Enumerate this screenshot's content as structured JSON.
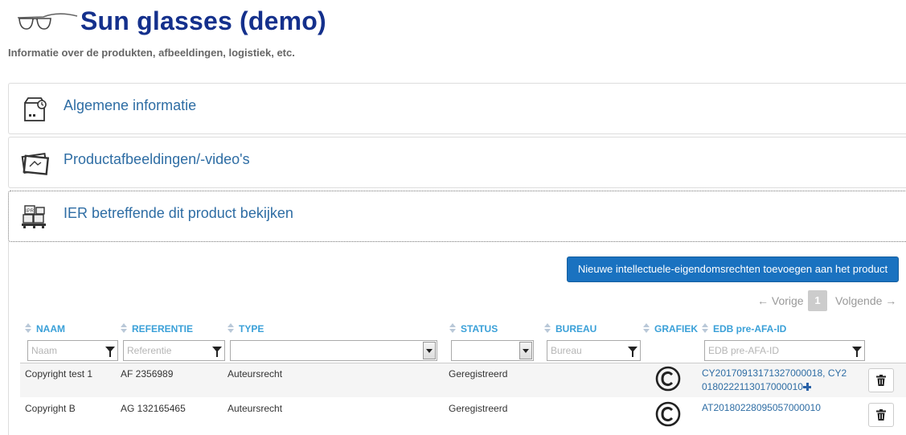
{
  "header": {
    "title": "Sun glasses (demo)",
    "subtitle": "Informatie over de produkten, afbeeldingen, logistiek, etc."
  },
  "panels": [
    {
      "label": "Algemene informatie",
      "icon": "box-icon"
    },
    {
      "label": "Productafbeeldingen/-video's",
      "icon": "photos-icon"
    },
    {
      "label": "IER betreffende dit product bekijken",
      "icon": "ipr-pallet-icon"
    }
  ],
  "toolbar": {
    "add_button": "Nieuwe intellectuele-eigendomsrechten toevoegen aan het product"
  },
  "pager": {
    "prev": "← Vorige",
    "page": "1",
    "next": "Volgende →"
  },
  "table": {
    "columns": [
      {
        "label": "NAAM",
        "sortable": true,
        "filter_placeholder": "Naam",
        "filter_type": "text"
      },
      {
        "label": "REFERENTIE",
        "sortable": true,
        "filter_placeholder": "Referentie",
        "filter_type": "text"
      },
      {
        "label": "TYPE",
        "sortable": true,
        "filter_placeholder": "",
        "filter_type": "select"
      },
      {
        "label": "STATUS",
        "sortable": true,
        "filter_placeholder": "",
        "filter_type": "select"
      },
      {
        "label": "BUREAU",
        "sortable": true,
        "filter_placeholder": "Bureau",
        "filter_type": "text"
      },
      {
        "label": "GRAFIEK",
        "sortable": true
      },
      {
        "label": "EDB pre-AFA-ID",
        "sortable": true,
        "filter_placeholder": "EDB pre-AFA-ID",
        "filter_type": "text"
      }
    ],
    "rows": [
      {
        "naam": "Copyright test 1",
        "referentie": "AF 2356989",
        "type": "Auteursrecht",
        "status": "Geregistreerd",
        "bureau": "",
        "grafiek_icon": "copyright-icon",
        "edb_line1": "CY20170913171327000018, CY2",
        "edb_line2": "0180222113017000010"
      },
      {
        "naam": "Copyright B",
        "referentie": "AG 132165465",
        "type": "Auteursrecht",
        "status": "Geregistreerd",
        "bureau": "",
        "grafiek_icon": "copyright-icon",
        "edb_line1": "AT20180228095057000010",
        "edb_line2": ""
      }
    ]
  },
  "colors": {
    "title": "#14308c",
    "link": "#2e6da4",
    "header_text": "#3aa0d8",
    "primary_button": "#1a72c0"
  }
}
